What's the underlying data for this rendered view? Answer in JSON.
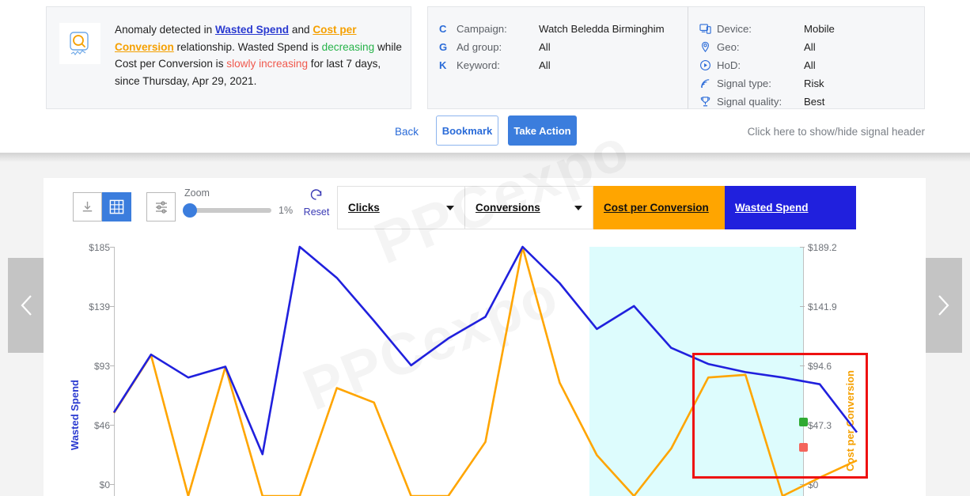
{
  "anomaly_card": {
    "icon": "magnifier-chart-icon",
    "text_parts": [
      {
        "t": "Anomaly detected in ",
        "style": "plain"
      },
      {
        "t": "Wasted Spend",
        "style": "link-blue"
      },
      {
        "t": " and ",
        "style": "plain"
      },
      {
        "t": "Cost per Conversion",
        "style": "link-orange"
      },
      {
        "t": " relationship. Wasted Spend is ",
        "style": "plain"
      },
      {
        "t": "decreasing",
        "style": "green"
      },
      {
        "t": " while Cost per Conversion is ",
        "style": "plain"
      },
      {
        "t": "slowly increasing",
        "style": "red"
      },
      {
        "t": " for last 7 days, since Thursday, Apr 29, 2021.",
        "style": "plain"
      }
    ]
  },
  "campaign_card": {
    "rows": [
      {
        "icon": "campaign-c-icon",
        "glyph": "C",
        "key": "Campaign:",
        "value": "Watch Beledda Birminghim"
      },
      {
        "icon": "adgroup-g-icon",
        "glyph": "G",
        "key": "Ad group:",
        "value": "All"
      },
      {
        "icon": "keyword-k-icon",
        "glyph": "K",
        "key": "Keyword:",
        "value": "All"
      }
    ]
  },
  "targeting_card": {
    "rows": [
      {
        "icon": "device-icon",
        "key": "Device:",
        "value": "Mobile"
      },
      {
        "icon": "geo-pin-icon",
        "key": "Geo:",
        "value": "All"
      },
      {
        "icon": "clock-icon",
        "key": "HoD:",
        "value": "All"
      },
      {
        "icon": "signal-waves-icon",
        "key": "Signal type:",
        "value": "Risk"
      },
      {
        "icon": "trophy-icon",
        "key": "Signal quality:",
        "value": "Best"
      }
    ]
  },
  "action_bar": {
    "back_label": "Back",
    "bookmark_label": "Bookmark",
    "take_action_label": "Take Action",
    "toggle_hint": "Click here to show/hide signal header"
  },
  "toolbar": {
    "download_icon": "download-icon",
    "table_icon": "table-grid-icon",
    "settings_icon": "sliders-icon",
    "zoom_label": "Zoom",
    "zoom_value": "1%",
    "zoom_percent": 1,
    "reset_icon": "reset-circular-arrow-icon",
    "reset_label": "Reset",
    "selects": [
      {
        "name": "clicks",
        "value": "Clicks"
      },
      {
        "name": "conversions",
        "value": "Conversions"
      }
    ],
    "metric_tabs": [
      {
        "name": "cost-per-conversion",
        "label": "Cost per Conversion",
        "bg": "#FFA500",
        "fg": "#101010"
      },
      {
        "name": "wasted-spend",
        "label": "Wasted Spend",
        "bg": "#2020DD",
        "fg": "#FFFFFF"
      }
    ]
  },
  "navigation": {
    "prev_icon": "chevron-left-icon",
    "next_icon": "chevron-right-icon"
  },
  "watermark": {
    "text": "PPCexpo"
  },
  "chart_data": {
    "type": "line",
    "title": "",
    "xlabel": "",
    "grid": false,
    "legend_position": "top-tabs",
    "series": [
      {
        "name": "Wasted Spend",
        "color": "#2020DD",
        "axis": "left",
        "ylabel": "Wasted Spend",
        "values": [
          62,
          105,
          88,
          96,
          31,
          185,
          162,
          130,
          97,
          117,
          133,
          185,
          158,
          124,
          141,
          110,
          98,
          92,
          88,
          83,
          47.3
        ]
      },
      {
        "name": "Cost per Conversion",
        "color": "#FFA500",
        "axis": "right",
        "ylabel": "Cost per Conversion",
        "values": [
          63,
          107,
          0,
          98,
          0,
          0,
          82,
          71,
          0,
          0,
          41,
          189,
          86,
          31,
          0,
          36,
          90,
          92,
          0,
          14,
          27
        ]
      }
    ],
    "left_axis": {
      "label": "Wasted Spend",
      "color": "#2020DD",
      "ticks": [
        "$185",
        "$139",
        "$93",
        "$46",
        "$0"
      ],
      "ylim": [
        0,
        185
      ]
    },
    "right_axis": {
      "label": "Cost per Conversion",
      "color": "#FFA500",
      "ticks": [
        "$189.2",
        "$141.9",
        "$94.6",
        "$47.3",
        "$0"
      ],
      "ylim": [
        0,
        189.2
      ]
    },
    "annotations": [
      {
        "name": "highlight-band",
        "type": "region",
        "color": "#DDFCFD"
      },
      {
        "name": "anomaly-box",
        "type": "rect",
        "color": "#EE1111"
      },
      {
        "name": "wasted-spend-endpoint",
        "type": "marker",
        "color": "#2FAA32",
        "label": "$47.3"
      },
      {
        "name": "cost-per-conversion-endpoint",
        "type": "marker",
        "color": "#F4655C",
        "label": ""
      }
    ]
  }
}
